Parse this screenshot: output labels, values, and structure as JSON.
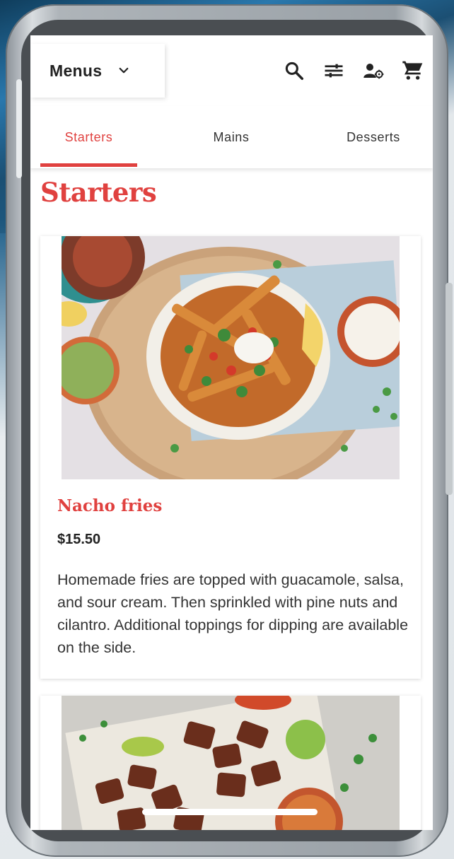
{
  "header": {
    "menu_label": "Menus",
    "icons": [
      "search-icon",
      "filter-icon",
      "user-settings-icon",
      "cart-icon"
    ]
  },
  "tabs": [
    {
      "label": "Starters",
      "active": true
    },
    {
      "label": "Mains",
      "active": false
    },
    {
      "label": "Desserts",
      "active": false
    }
  ],
  "section": {
    "title": "Starters"
  },
  "items": [
    {
      "name": "Nacho fries",
      "price": "$15.50",
      "description": "Homemade fries are topped with guacamole, salsa, and sour cream. Then sprinkled with pine nuts and cilantro. Additional toppings for dipping are available on the side."
    }
  ],
  "colors": {
    "accent": "#e0413f",
    "text": "#222222",
    "background": "#ffffff"
  }
}
